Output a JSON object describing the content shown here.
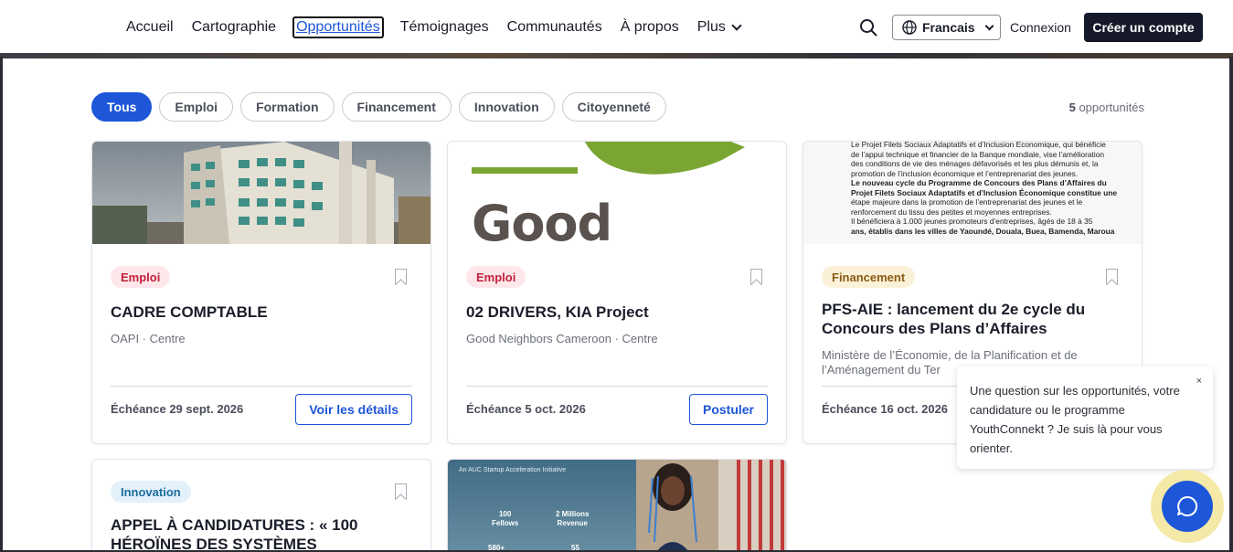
{
  "nav": {
    "items": [
      "Accueil",
      "Cartographie",
      "Opportunités",
      "Témoignages",
      "Communautés",
      "À propos"
    ],
    "more_label": "Plus",
    "active": "Opportunités"
  },
  "header": {
    "language": "Francais",
    "login": "Connexion",
    "signup": "Créer un compte"
  },
  "filters": [
    "Tous",
    "Emploi",
    "Formation",
    "Financement",
    "Innovation",
    "Citoyenneté"
  ],
  "results": {
    "count": "5",
    "label": "opportunités"
  },
  "cards": [
    {
      "category": "Emploi",
      "title": "CADRE COMPTABLE",
      "org": "OAPI · Centre",
      "deadline": "Échéance 29 sept. 2026",
      "action": "Voir les détails"
    },
    {
      "category": "Emploi",
      "title": "02 DRIVERS, KIA Project",
      "org": "Good Neighbors Cameroon · Centre",
      "deadline": "Échéance 5 oct. 2026",
      "action": "Postuler",
      "image_text": "Good"
    },
    {
      "category": "Financement",
      "title": "PFS-AIE : lancement du 2e cycle du Concours des Plans d’Affaires",
      "org": "Ministère de l’Économie, de la Planification et de l’Aménagement du Ter",
      "deadline": "Échéance 16 oct. 2026",
      "image_lines": [
        "Le Projet Filets Sociaux Adaptatifs et d’Inclusion Économique, qui bénéficie",
        "de l’appui technique et financier de la Banque mondiale, vise l’amélioration",
        "des conditions de vie des ménages défavorisés et les plus démunis et, la",
        "promotion de l’inclusion économique et l’entreprenariat des jeunes.",
        "Le nouveau cycle du Programme de Concours des Plans d’Affaires du",
        "Projet Filets Sociaux Adaptatifs et d’Inclusion Économique constitue une",
        "étape majeure dans la promotion de l’entreprenariat des jeunes et le",
        "renforcement du tissu des petites et moyennes entreprises.",
        "Il bénéficiera à 1.000 jeunes promoteurs d’entreprises, âgés de 18 à 35",
        "ans, établis dans les villes de Yaoundé, Douala, Buea, Bamenda, Maroua"
      ]
    },
    {
      "category": "Innovation",
      "title": "APPEL À CANDIDATURES : « 100 HÉROÏNES DES SYSTÈMES"
    },
    {
      "image_title": "An AUC Startup Acceleration Initiative",
      "stats": [
        "100",
        "Fellows",
        "2 Millions",
        "Revenue",
        "580+",
        "55"
      ]
    }
  ],
  "chat": {
    "message": "Une question sur les opportunités, votre candidature ou le programme YouthConnekt ? Je suis là pour vous orienter.",
    "close": "×"
  },
  "colors": {
    "primary": "#1d56d8",
    "dark": "#15192a",
    "chat_ring": "#f5e9a8"
  }
}
